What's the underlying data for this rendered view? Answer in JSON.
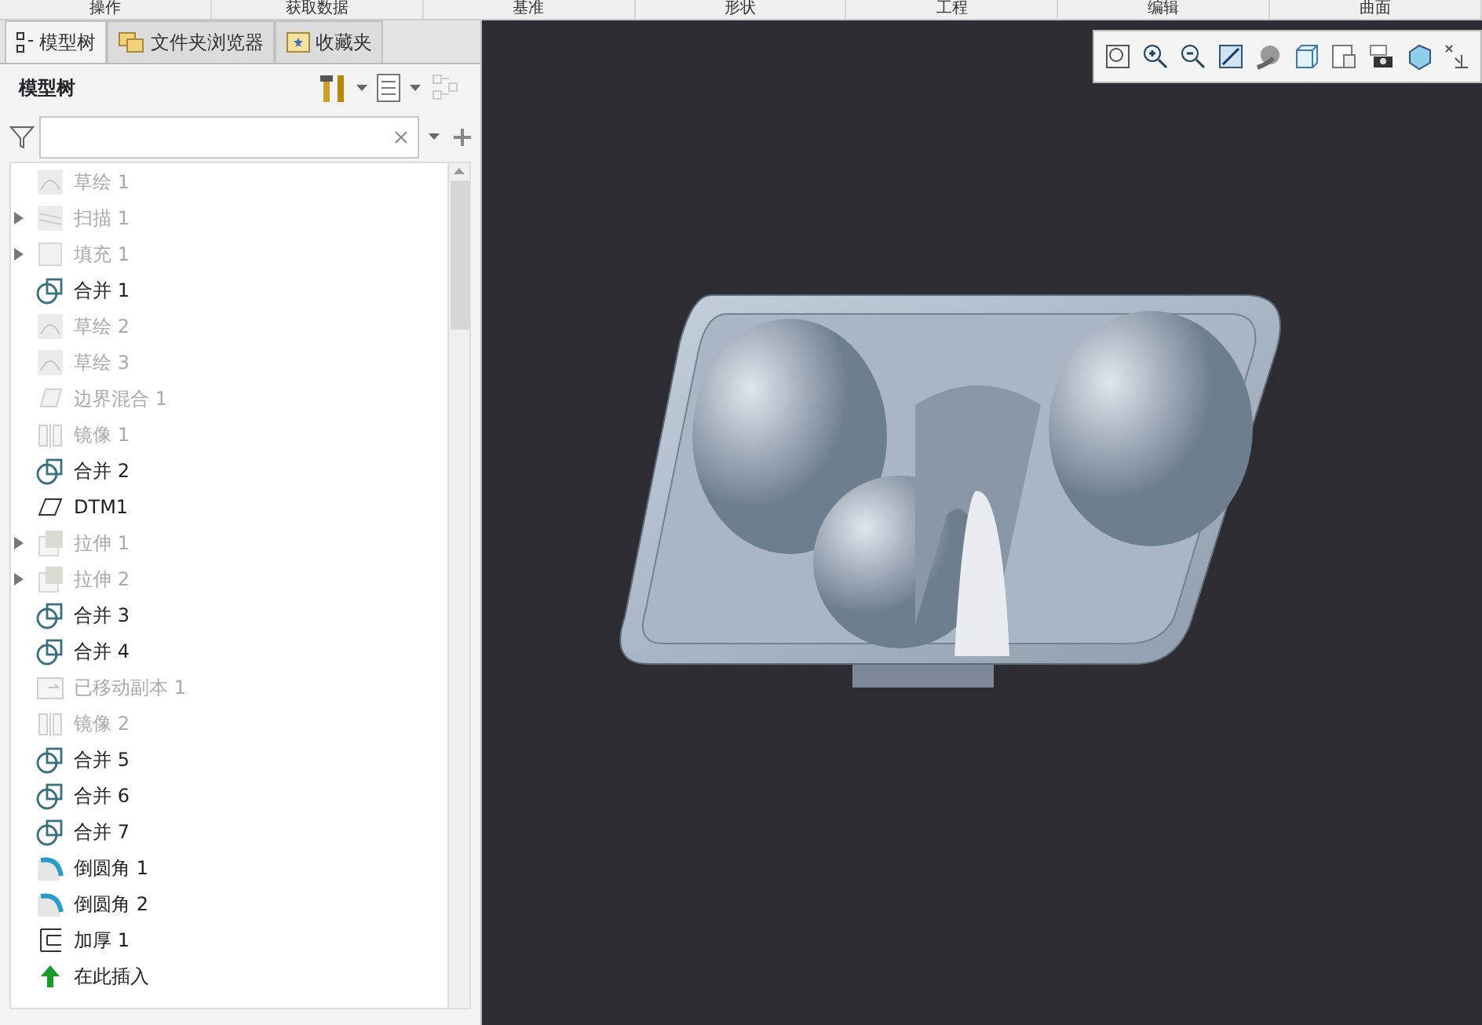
{
  "ribbon_groups": [
    "操作",
    "获取数据",
    "基准",
    "形状",
    "工程",
    "编辑",
    "曲面"
  ],
  "tabs": [
    {
      "label": "模型树",
      "selected": true
    },
    {
      "label": "文件夹浏览器",
      "selected": false
    },
    {
      "label": "收藏夹",
      "selected": false
    }
  ],
  "panel_title": "模型树",
  "tree": [
    {
      "kind": "sketch",
      "label": "草绘 1",
      "disabled": true
    },
    {
      "kind": "sweep",
      "label": "扫描 1",
      "disabled": true,
      "expanded": false
    },
    {
      "kind": "fill",
      "label": "填充 1",
      "disabled": true,
      "expanded": false
    },
    {
      "kind": "merge",
      "label": "合并 1",
      "disabled": false
    },
    {
      "kind": "sketch",
      "label": "草绘 2",
      "disabled": true
    },
    {
      "kind": "sketch",
      "label": "草绘 3",
      "disabled": true
    },
    {
      "kind": "boundary",
      "label": "边界混合 1",
      "disabled": true
    },
    {
      "kind": "mirror",
      "label": "镜像 1",
      "disabled": true
    },
    {
      "kind": "merge",
      "label": "合并 2",
      "disabled": false
    },
    {
      "kind": "datum",
      "label": "DTM1",
      "disabled": false
    },
    {
      "kind": "extrude",
      "label": "拉伸 1",
      "disabled": true,
      "expanded": false
    },
    {
      "kind": "extrude",
      "label": "拉伸 2",
      "disabled": true,
      "expanded": false
    },
    {
      "kind": "merge",
      "label": "合并 3",
      "disabled": false
    },
    {
      "kind": "merge",
      "label": "合并 4",
      "disabled": false
    },
    {
      "kind": "copy",
      "label": "已移动副本 1",
      "disabled": true
    },
    {
      "kind": "mirror",
      "label": "镜像 2",
      "disabled": true
    },
    {
      "kind": "merge",
      "label": "合并 5",
      "disabled": false
    },
    {
      "kind": "merge",
      "label": "合并 6",
      "disabled": false
    },
    {
      "kind": "merge",
      "label": "合并 7",
      "disabled": false
    },
    {
      "kind": "round",
      "label": "倒圆角 1",
      "disabled": false
    },
    {
      "kind": "round",
      "label": "倒圆角 2",
      "disabled": false
    },
    {
      "kind": "thicken",
      "label": "加厚 1",
      "disabled": false
    },
    {
      "kind": "insert",
      "label": "在此插入",
      "disabled": false
    }
  ]
}
